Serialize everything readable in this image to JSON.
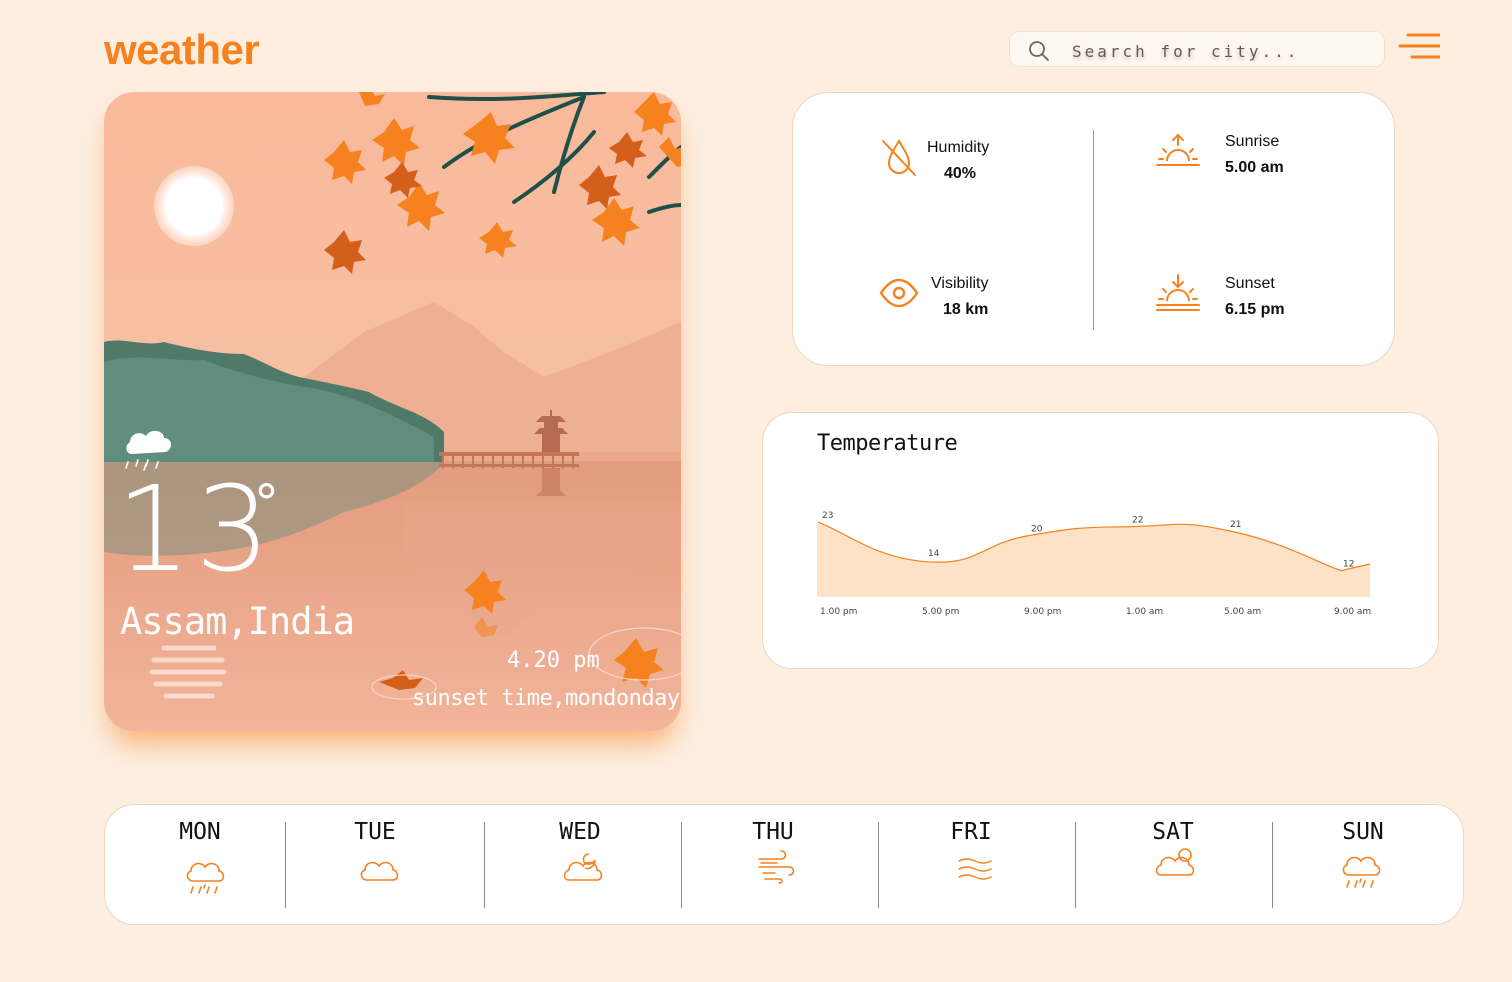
{
  "app": {
    "logo": "weather"
  },
  "search": {
    "placeholder": "Search for city..."
  },
  "hero": {
    "temperature": "13",
    "degree": "°",
    "location": "Assam,India",
    "time": "4.20 pm",
    "day_text": "sunset time,mondonday",
    "weather_icon": "cloud-rain-icon"
  },
  "stats": {
    "humidity": {
      "label": "Humidity",
      "value": "40%",
      "icon": "humidity-off-icon"
    },
    "sunrise": {
      "label": "Sunrise",
      "value": "5.00 am",
      "icon": "sunrise-icon"
    },
    "visibility": {
      "label": "Visibility",
      "value": "18 km",
      "icon": "eye-icon"
    },
    "sunset": {
      "label": "Sunset",
      "value": "6.15 pm",
      "icon": "sunset-icon"
    }
  },
  "temperature_chart": {
    "title": "Temperature"
  },
  "chart_data": {
    "type": "area",
    "title": "Temperature",
    "categories": [
      "1.00 pm",
      "5.00 pm",
      "9.00 pm",
      "1.00 am",
      "5.00 am",
      "9.00 am"
    ],
    "points": [
      {
        "x": "1.00 pm",
        "y": 23
      },
      {
        "x": "5.00 pm",
        "y": 14
      },
      {
        "x": "9.00 pm",
        "y": 20
      },
      {
        "x": "1.00 am",
        "y": 22
      },
      {
        "x": "5.00 am",
        "y": 21
      },
      {
        "x": "9.00 am",
        "y": 12
      }
    ],
    "colors": {
      "line": "#f5821f",
      "fill": "#fde2c8"
    },
    "grid": false
  },
  "week": [
    {
      "name": "MON",
      "icon": "cloud-rain-icon"
    },
    {
      "name": "TUE",
      "icon": "cloud-icon"
    },
    {
      "name": "WED",
      "icon": "cloud-moon-icon"
    },
    {
      "name": "THU",
      "icon": "wind-icon"
    },
    {
      "name": "FRI",
      "icon": "haze-icon"
    },
    {
      "name": "SAT",
      "icon": "cloud-sun-icon"
    },
    {
      "name": "SUN",
      "icon": "cloud-rain-icon"
    }
  ],
  "theme": {
    "accent": "#f5821f",
    "background": "#fdeee0"
  }
}
